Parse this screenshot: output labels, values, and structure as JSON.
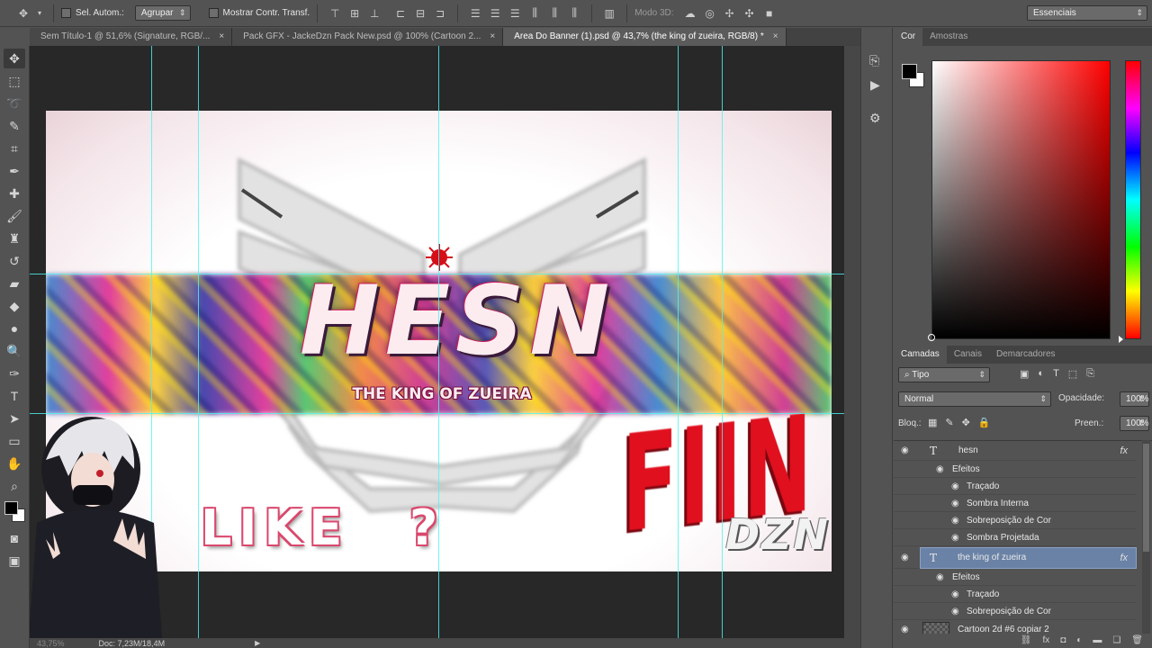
{
  "options_bar": {
    "auto_select_label": "Sel. Autom.:",
    "group_value": "Agrupar",
    "transform_label": "Mostrar Contr. Transf.",
    "mode3d_label": "Modo 3D:",
    "workspace_value": "Essenciais"
  },
  "tabs": [
    {
      "label": "Sem Título-1 @ 51,6% (Signature, RGB/...",
      "active": false
    },
    {
      "label": "Pack GFX - JackeDzn Pack New.psd @ 100% (Cartoon 2...",
      "active": false
    },
    {
      "label": "Area Do Banner (1).psd @ 43,7% (the king of zueira, RGB/8) *",
      "active": true
    }
  ],
  "tab_close": "×",
  "banner": {
    "main_text": "HESN",
    "subtitle": "THE KING OF ZUEIRA",
    "like_text": "LIKE ?",
    "fiin_text": "FIIN",
    "dzn_text": "DZN"
  },
  "status": {
    "zoom": "43,75%",
    "doc": "Doc: 7,23M/18,4M"
  },
  "color_panel": {
    "tabs": [
      "Cor",
      "Amostras"
    ],
    "fg_color": "#000000",
    "bg_color": "#ffffff",
    "hue_color": "#ff0000"
  },
  "layers_panel": {
    "tabs": [
      "Camadas",
      "Canais",
      "Demarcadores"
    ],
    "filter_value": "Tipo",
    "blend_mode": "Normal",
    "opacity_label": "Opacidade:",
    "opacity_value": "100%",
    "lock_label": "Bloq.:",
    "fill_label": "Preen.:",
    "fill_value": "100%",
    "layers": [
      {
        "kind": "text",
        "name": "hesn",
        "fx": "fx",
        "selected": false
      },
      {
        "kind": "effects",
        "name": "Efeitos"
      },
      {
        "kind": "effect",
        "name": "Traçado"
      },
      {
        "kind": "effect",
        "name": "Sombra Interna"
      },
      {
        "kind": "effect",
        "name": "Sobreposição de Cor"
      },
      {
        "kind": "effect",
        "name": "Sombra Projetada"
      },
      {
        "kind": "text",
        "name": "the king of zueira",
        "fx": "fx",
        "selected": true
      },
      {
        "kind": "effects",
        "name": "Efeitos"
      },
      {
        "kind": "effect",
        "name": "Traçado"
      },
      {
        "kind": "effect",
        "name": "Sobreposição de Cor"
      },
      {
        "kind": "image",
        "name": "Cartoon 2d #6 copiar 2"
      }
    ]
  },
  "icons": {
    "eye": "eye-icon",
    "text_layer": "T"
  }
}
